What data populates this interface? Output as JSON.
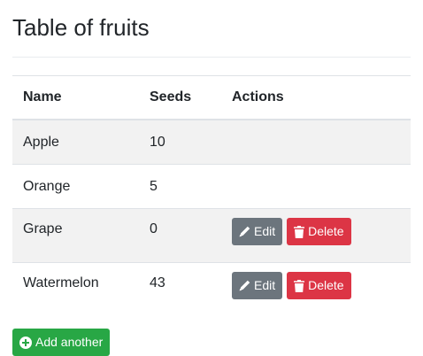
{
  "page": {
    "title": "Table of fruits"
  },
  "table": {
    "headers": [
      "Name",
      "Seeds",
      "Actions"
    ],
    "rows": [
      {
        "name": "Apple",
        "seeds": "10",
        "actions": false
      },
      {
        "name": "Orange",
        "seeds": "5",
        "actions": false
      },
      {
        "name": "Grape",
        "seeds": "0",
        "actions": true
      },
      {
        "name": "Watermelon",
        "seeds": "43",
        "actions": true
      }
    ]
  },
  "actions": {
    "edit_label": "Edit",
    "delete_label": "Delete",
    "edit_icon": "pencil-icon",
    "delete_icon": "trash-icon"
  },
  "footer": {
    "add_label": "Add another",
    "add_icon": "plus-circle-icon"
  },
  "colors": {
    "edit": "#6c757d",
    "delete": "#dc3545",
    "add": "#28a745",
    "stripe": "#f2f2f2"
  }
}
